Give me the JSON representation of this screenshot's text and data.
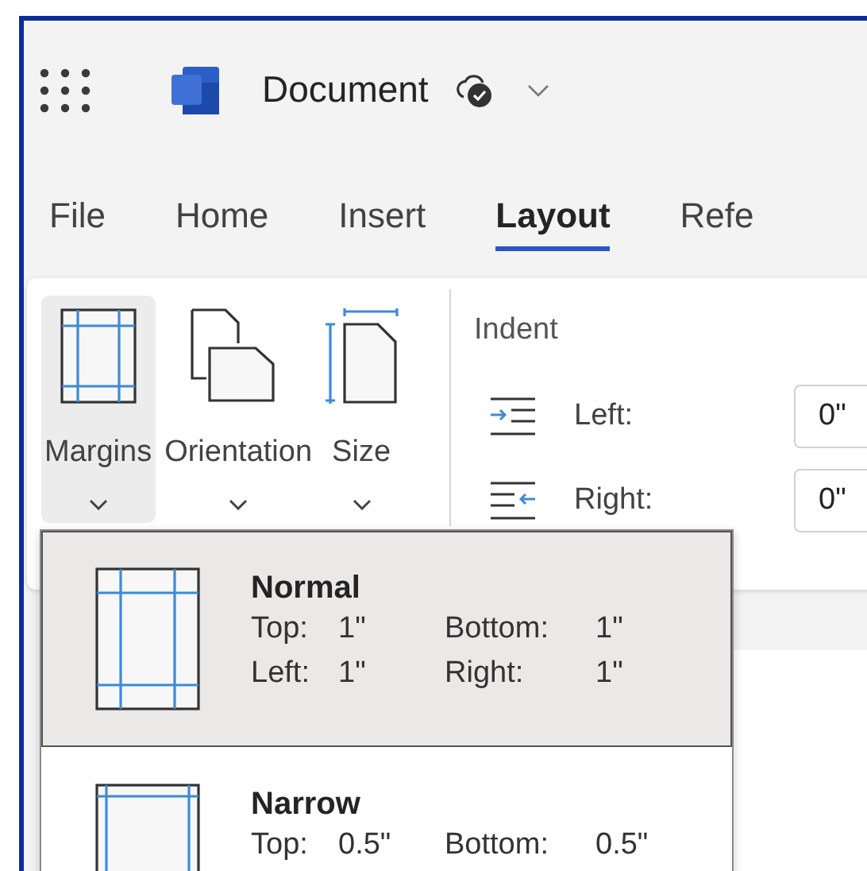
{
  "header": {
    "title": "Document"
  },
  "tabs": [
    {
      "label": "File",
      "selected": false
    },
    {
      "label": "Home",
      "selected": false
    },
    {
      "label": "Insert",
      "selected": false
    },
    {
      "label": "Layout",
      "selected": true
    },
    {
      "label": "Refe",
      "selected": false
    }
  ],
  "ribbon": {
    "buttons": [
      {
        "kind": "margins",
        "label": "Margins",
        "expanded": true
      },
      {
        "kind": "orientation",
        "label": "Orientation",
        "expanded": false
      },
      {
        "kind": "size",
        "label": "Size",
        "expanded": false
      }
    ],
    "indent": {
      "title": "Indent",
      "rows": [
        {
          "kind": "left",
          "label": "Left:",
          "value": "0\""
        },
        {
          "kind": "right",
          "label": "Right:",
          "value": "0\""
        }
      ]
    }
  },
  "margins_menu": [
    {
      "kind": "normal",
      "name": "Normal",
      "selected": true,
      "fields": [
        {
          "label": "Top:",
          "value": "1\""
        },
        {
          "label": "Bottom:",
          "value": "1\""
        },
        {
          "label": "Left:",
          "value": "1\""
        },
        {
          "label": "Right:",
          "value": "1\""
        }
      ]
    },
    {
      "kind": "narrow",
      "name": "Narrow",
      "selected": false,
      "fields": [
        {
          "label": "Top:",
          "value": "0.5\""
        },
        {
          "label": "Bottom:",
          "value": "0.5\""
        }
      ]
    }
  ]
}
